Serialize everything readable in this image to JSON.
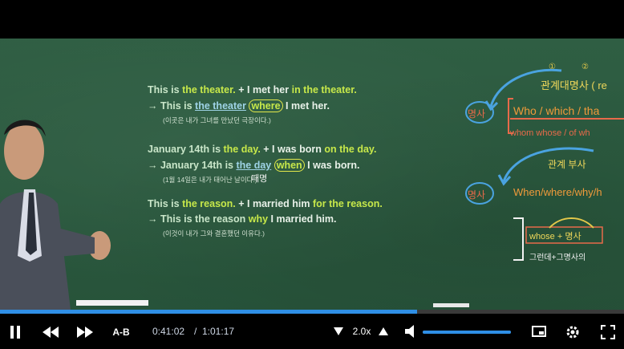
{
  "board": {
    "ex1_line1_a": "This is ",
    "ex1_line1_b": "the theater.",
    "ex1_line1_c": " + I met her ",
    "ex1_line1_d": "in the theater.",
    "ex1_line2_a": "→ This is ",
    "ex1_line2_b": "the theater",
    "ex1_line2_c": "where",
    "ex1_line2_d": " I met her.",
    "ex1_note": "(이곳은 내가 그녀를 만났던 극장이다.)",
    "ex2_line1_a": "January 14th is ",
    "ex2_line1_b": "the day.",
    "ex2_line1_c": " + I was born ",
    "ex2_line1_d": "on the day.",
    "ex2_line2_a": "→ January 14th is ",
    "ex2_line2_b": "the day",
    "ex2_line2_c": "when",
    "ex2_line2_d": " I was born.",
    "ex2_note": "(1월 14일은 내가 태어난 날이다.)",
    "ex2_handwrite": "때명",
    "ex3_line1_a": "This is ",
    "ex3_line1_b": "the reason.",
    "ex3_line1_c": " + I married him ",
    "ex3_line1_d": "for the reason.",
    "ex3_line2_a": "→ This is the reason ",
    "ex3_line2_b": "why",
    "ex3_line2_c": " I married him.",
    "ex3_note": "(이것이 내가 그와 결혼했던 이유다.)"
  },
  "handwriting": {
    "title1": "관계대명사 ( re",
    "noun1": "명사",
    "list1": "Who / which / tha",
    "list1b": "whom   whose / of wh",
    "title2": "관계 부사",
    "noun2": "명사",
    "list2": "When/where/why/h",
    "whose_box": "whose + 명사",
    "whose_note": "그런데+그명사의",
    "num1": "①",
    "num2": "②"
  },
  "player": {
    "current_time": "0:41:02",
    "separator": "/",
    "duration": "1:01:17",
    "speed": "2.0x",
    "ab_label": "A-B",
    "progress": 0.669,
    "volume": 1.0,
    "colors": {
      "accent": "#2f8fe6",
      "bg": "#000000"
    },
    "icons": [
      "pause-icon",
      "rewind-icon",
      "fast-forward-icon",
      "speed-down-icon",
      "speed-up-icon",
      "volume-icon",
      "pip-icon",
      "settings-icon",
      "fullscreen-icon"
    ]
  }
}
